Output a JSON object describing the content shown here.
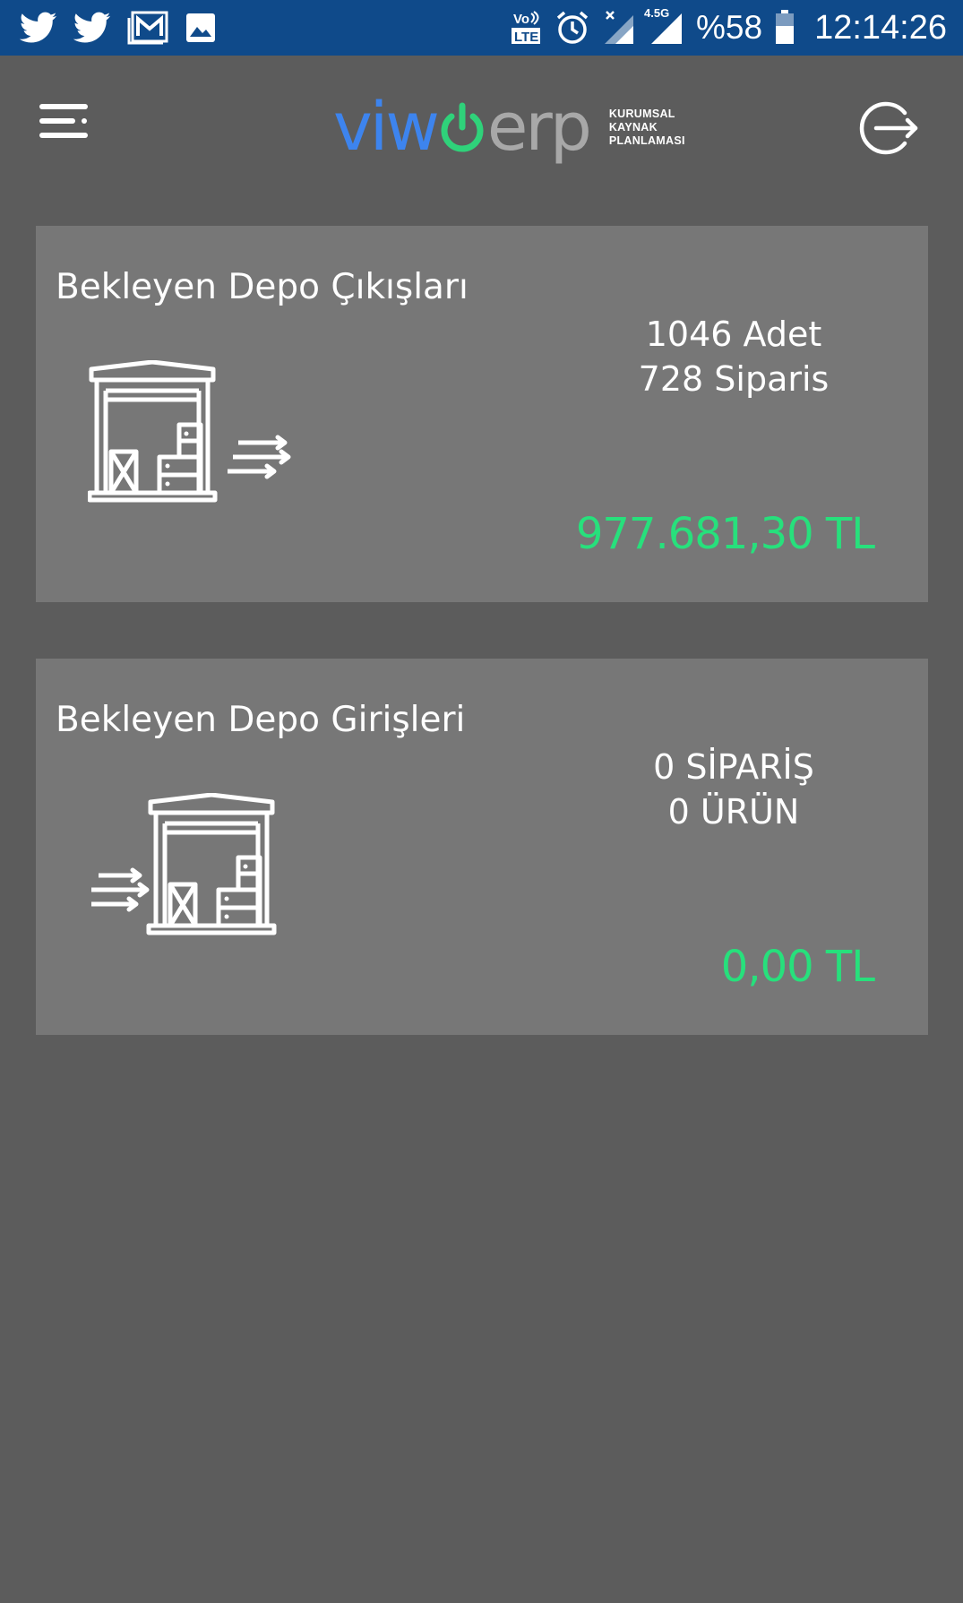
{
  "status_bar": {
    "battery": "%58",
    "time": "12:14:26",
    "network": "4.5G",
    "volte": "Vo LTE",
    "icons": [
      "twitter-icon",
      "twitter-icon",
      "gmail-icon",
      "image-icon",
      "volte-icon",
      "alarm-icon",
      "signal-icon",
      "signal-icon",
      "battery-icon"
    ]
  },
  "header": {
    "logo_viw": "viw",
    "logo_erp": "erp",
    "logo_sub_line1": "KURUMSAL",
    "logo_sub_line2": "KAYNAK",
    "logo_sub_line3": "PLANLAMASI",
    "menu_icon": "menu-icon",
    "logout_icon": "logout-icon"
  },
  "cards": [
    {
      "title": "Bekleyen Depo Çıkışları",
      "stat1": "1046 Adet",
      "stat2": "728 Siparis",
      "amount": "977.681,30 TL",
      "icon": "warehouse-out-icon"
    },
    {
      "title": "Bekleyen Depo Girişleri",
      "stat1": "0 SİPARİŞ",
      "stat2": "0 ÜRÜN",
      "amount": "0,00 TL",
      "icon": "warehouse-in-icon"
    }
  ],
  "colors": {
    "status_bar": "#0f4a8a",
    "background": "#5c5c5c",
    "card": "#777777",
    "amount": "#27e07c",
    "logo_blue": "#3d84ee",
    "logo_green": "#2fd27a"
  }
}
